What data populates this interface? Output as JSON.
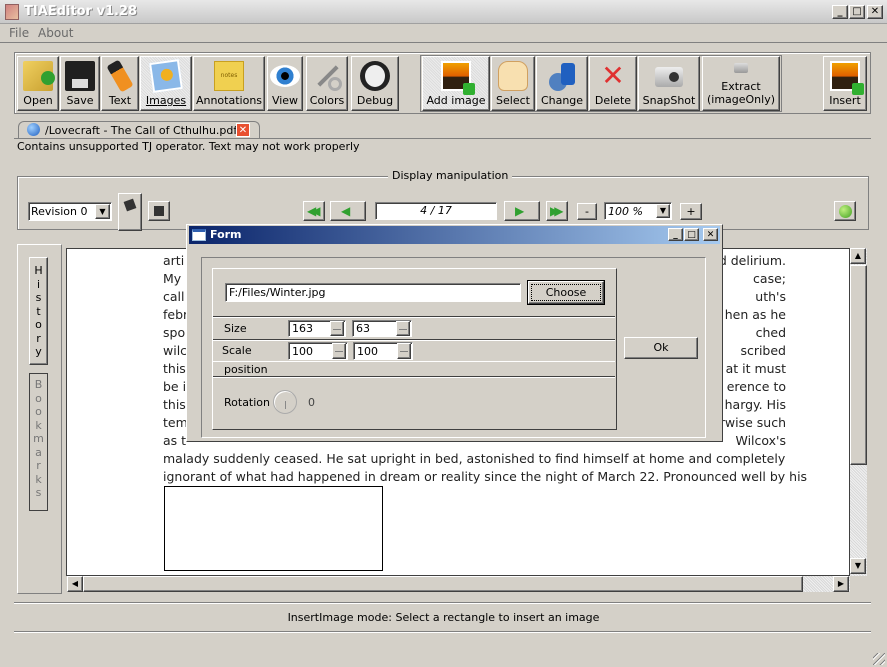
{
  "window": {
    "title": "TIAEditor v1.28",
    "minimize": "_",
    "maximize": "□",
    "close": "✕"
  },
  "menu": [
    "File",
    "About"
  ],
  "toolbar": {
    "open": "Open",
    "save": "Save",
    "text": "Text",
    "images": "Images",
    "annotations": "Annotations",
    "view": "View",
    "colors": "Colors",
    "debug": "Debug",
    "add_image": "Add image",
    "select": "Select",
    "change": "Change",
    "delete": "Delete",
    "snapshot": "SnapShot",
    "extract_line1": "Extract",
    "extract_line2": "(imageOnly)",
    "insert": "Insert"
  },
  "document_tab": {
    "label": "/Lovecraft - The Call of Cthulhu.pdf"
  },
  "warning": "Contains unsupported TJ operator. Text may not work properly",
  "display": {
    "group_title": "Display manipulation",
    "revision": "Revision 0",
    "page": "4 / 17",
    "zoom": "100 %",
    "zoom_out": "-",
    "zoom_in": "+"
  },
  "sidebar": {
    "history": "History",
    "bookmarks": "Bookmarks"
  },
  "document": {
    "lines_left": [
      "arti",
      "My",
      "call",
      "febr",
      "spo",
      "wilc",
      "this",
      "be i",
      "this",
      "tem",
      "as t"
    ],
    "lines_right": [
      "d delirium.",
      "case;",
      "uth's",
      "hen as he",
      "ched",
      "scribed",
      "at it must",
      "erence to",
      "hargy. His",
      "rwise such",
      "Wilcox's"
    ],
    "full_lines": [
      "malady suddenly ceased. He sat upright in bed, astonished to find himself at home and completely",
      "ignorant of what had happened in dream or reality since the night of March 22. Pronounced well by his"
    ]
  },
  "dialog": {
    "title": "Form",
    "file_path": "F:/Files/Winter.jpg",
    "choose": "Choose",
    "size_label": "Size",
    "size_w": "163",
    "size_h": "63",
    "scale_label": "Scale",
    "scale_x": "100",
    "scale_y": "100",
    "position_label": "position",
    "rotation_label": "Rotation",
    "rotation_value": "0",
    "ok": "Ok"
  },
  "status": "InsertImage mode: Select a rectangle to insert an image"
}
